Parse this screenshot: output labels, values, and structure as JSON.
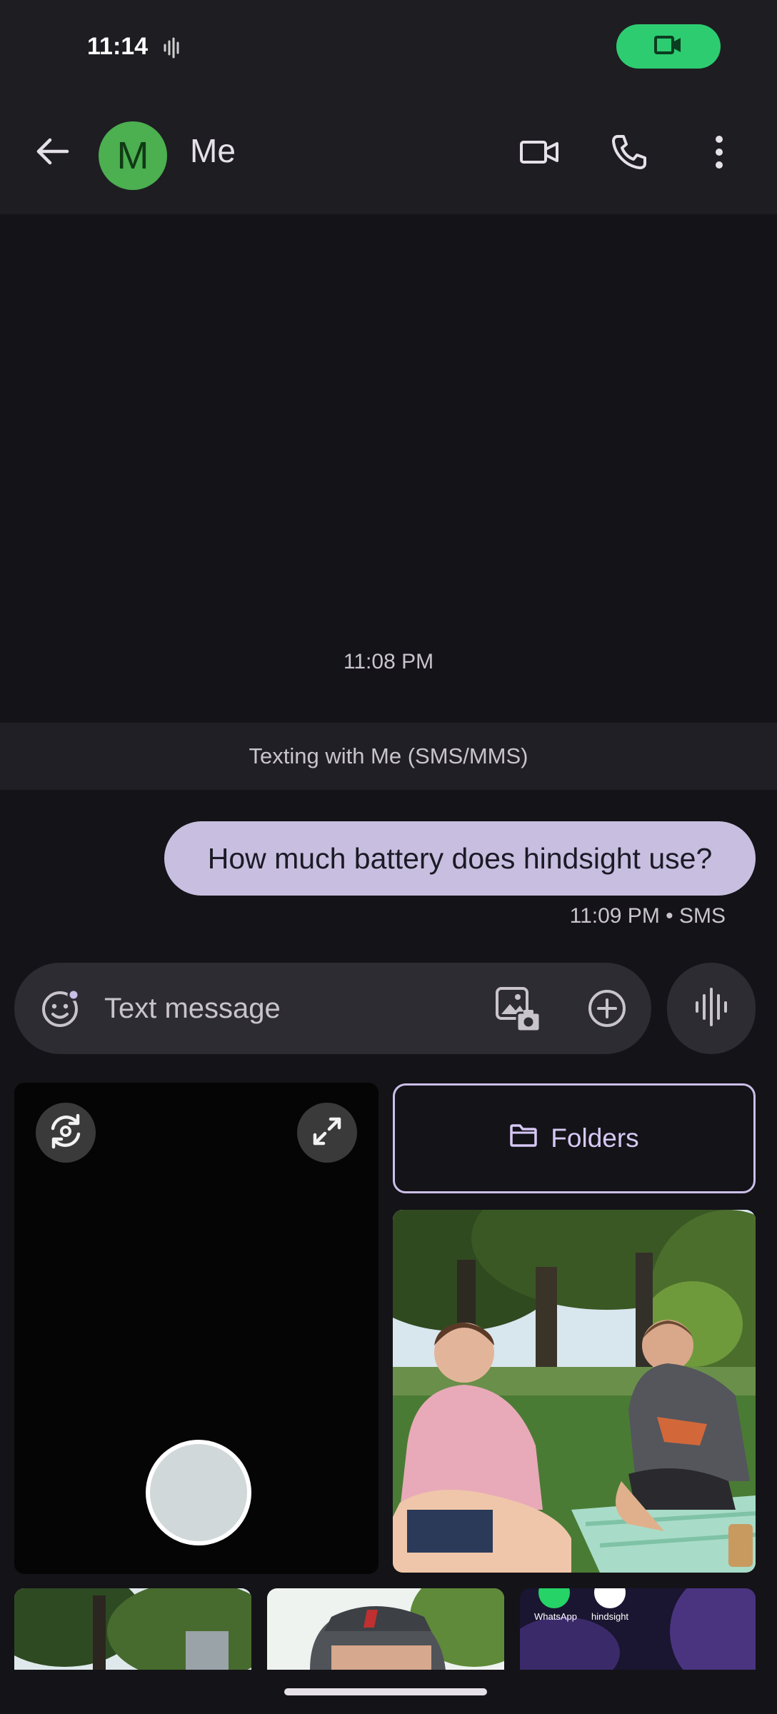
{
  "status_bar": {
    "time": "11:14"
  },
  "app_bar": {
    "avatar_letter": "M",
    "title": "Me"
  },
  "conversation": {
    "timestamp": "11:08 PM",
    "banner": "Texting with Me (SMS/MMS)",
    "messages": [
      {
        "text": "How much battery does hindsight use?",
        "meta": "11:09 PM • SMS",
        "direction": "outgoing"
      }
    ]
  },
  "composer": {
    "placeholder": "Text message"
  },
  "gallery": {
    "folders_label": "Folders",
    "thumb_labels": [
      "WhatsApp",
      "hindsight"
    ]
  },
  "colors": {
    "accent": "#2ecc71",
    "avatar": "#4caf50",
    "bubble": "#c8bfe0",
    "folders_border": "#cbbfe8"
  },
  "icons": [
    "audio-wave-icon",
    "video-camera-icon",
    "back-arrow-icon",
    "phone-icon",
    "more-vert-icon",
    "emoji-icon",
    "gallery-icon",
    "add-icon",
    "voice-icon",
    "flip-camera-icon",
    "expand-icon",
    "folder-icon"
  ]
}
